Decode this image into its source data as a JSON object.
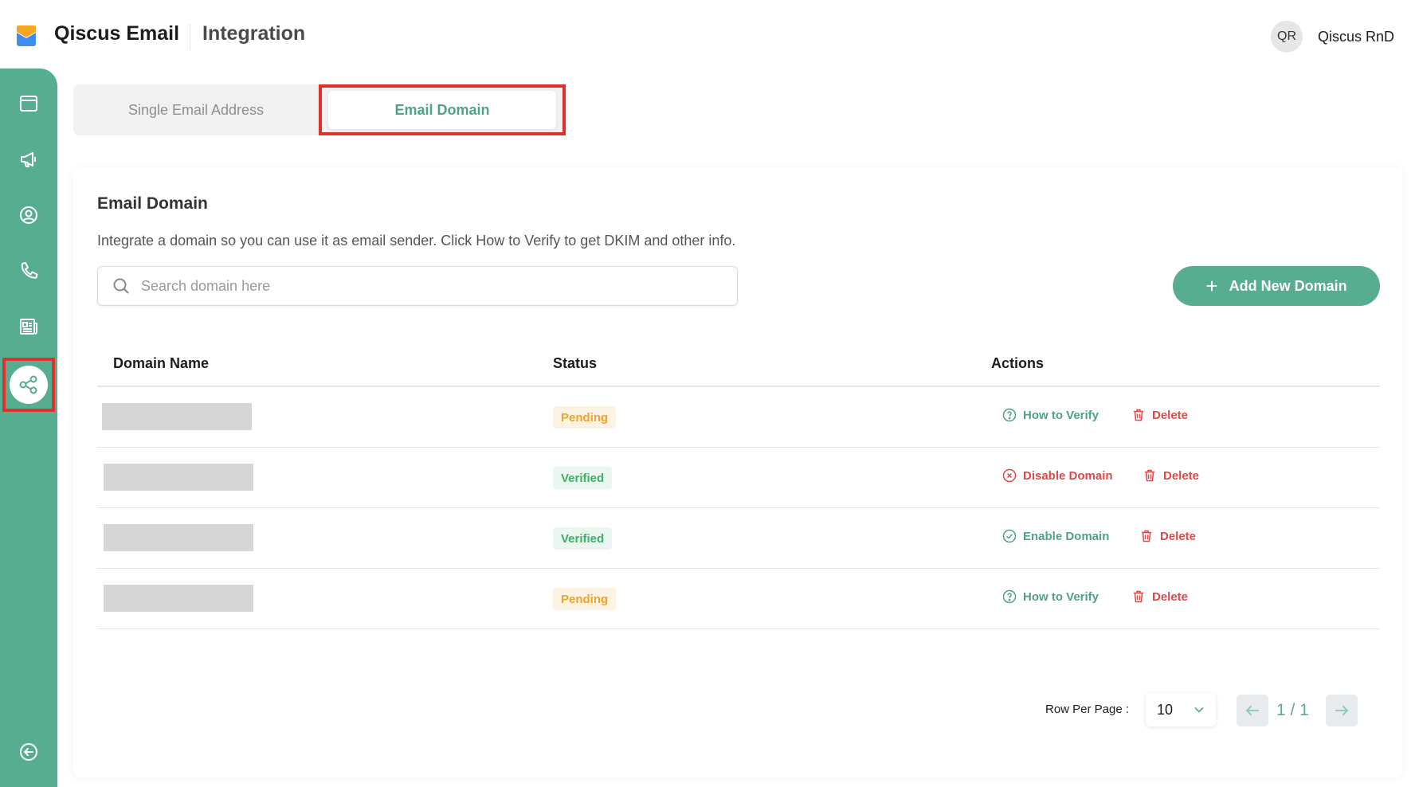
{
  "header": {
    "app_name": "Qiscus Email",
    "page_title": "Integration",
    "user_initials": "QR",
    "user_name": "Qiscus RnD"
  },
  "sidebar": {
    "items": [
      {
        "icon": "browser-window-icon"
      },
      {
        "icon": "megaphone-icon"
      },
      {
        "icon": "user-circle-icon"
      },
      {
        "icon": "phone-icon"
      },
      {
        "icon": "newspaper-icon"
      },
      {
        "icon": "share-nodes-icon",
        "active": true
      },
      {
        "icon": "collapse-arrow-icon"
      }
    ]
  },
  "tabs": [
    {
      "label": "Single Email Address",
      "active": false
    },
    {
      "label": "Email Domain",
      "active": true
    }
  ],
  "card": {
    "title": "Email Domain",
    "description": "Integrate a domain so you can use it as email sender. Click How to Verify to get DKIM and other info.",
    "search_placeholder": "Search domain here",
    "add_button": "Add New Domain"
  },
  "table": {
    "columns": [
      "Domain Name",
      "Status",
      "Actions"
    ],
    "rows": [
      {
        "status": "Pending",
        "action1": "How to Verify",
        "action2": "Delete"
      },
      {
        "status": "Verified",
        "action1": "Disable Domain",
        "action2": "Delete"
      },
      {
        "status": "Verified",
        "action1": "Enable Domain",
        "action2": "Delete"
      },
      {
        "status": "Pending",
        "action1": "How to Verify",
        "action2": "Delete"
      }
    ]
  },
  "pagination": {
    "rows_label": "Row Per Page :",
    "rows_value": "10",
    "page": "1 / 1"
  },
  "colors": {
    "brand": "#57ad8f",
    "highlight": "#e0302a",
    "pending": "#eea22f",
    "verified": "#3eaf6a",
    "danger": "#e04848"
  }
}
